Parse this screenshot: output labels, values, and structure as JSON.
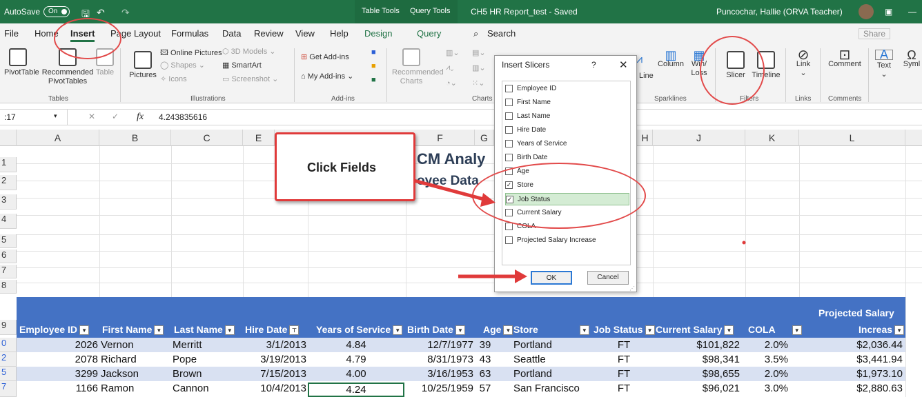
{
  "titlebar": {
    "autosave_label": "AutoSave",
    "autosave_state": "On",
    "context_tab_1": "Table Tools",
    "context_tab_2": "Query Tools",
    "doc_title": "CH5 HR Report_test - Saved",
    "user": "Puncochar, Hallie (ORVA Teacher)"
  },
  "tabs": [
    "File",
    "Home",
    "Insert",
    "Page Layout",
    "Formulas",
    "Data",
    "Review",
    "View",
    "Help",
    "Design",
    "Query"
  ],
  "search_label": "Search",
  "share_label": "Share",
  "ribbon": {
    "pivottable": "PivotTable",
    "recommended_pivottables_1": "Recommended",
    "recommended_pivottables_2": "PivotTables",
    "table": "Table",
    "tables_group": "Tables",
    "pictures": "Pictures",
    "online_pictures": "Online Pictures",
    "shapes": "Shapes",
    "icons": "Icons",
    "models_3d": "3D Models",
    "smartart": "SmartArt",
    "screenshot": "Screenshot",
    "illustrations_group": "Illustrations",
    "get_addins": "Get Add-ins",
    "my_addins": "My Add-ins",
    "addins_group": "Add-ins",
    "recommended_charts_1": "Recommended",
    "recommended_charts_2": "Charts",
    "charts_group": "Charts",
    "line": "Line",
    "column": "Column",
    "winloss_1": "Win/",
    "winloss_2": "Loss",
    "sparklines_group": "Sparklines",
    "slicer": "Slicer",
    "timeline": "Timeline",
    "filters_group": "Filters",
    "link": "Link",
    "links_group": "Links",
    "comment": "Comment",
    "comments_group": "Comments",
    "text": "Text",
    "symbols": "Syml"
  },
  "formula_bar": {
    "name_box": ":17",
    "fx": "fx",
    "value": "4.243835616"
  },
  "columns": [
    "A",
    "B",
    "C",
    "E",
    "F",
    "G",
    "H",
    "I",
    "J",
    "K",
    "L"
  ],
  "row_numbers": [
    "1",
    "2",
    "3",
    "4",
    "5",
    "6",
    "7",
    "8",
    "9",
    "0",
    "2",
    "5",
    "7"
  ],
  "background_text": {
    "title": "CM Analy",
    "subtitle": "oyee Data"
  },
  "table_headers": [
    "Employee ID",
    "First Name",
    "Last Name",
    "Hire Date",
    "Years of Service",
    "Birth Date",
    "Age",
    "Store",
    "Job Status",
    "Current Salary",
    "COLA",
    "Projected Salary",
    "Increas"
  ],
  "rows": [
    [
      "2026",
      "Vernon",
      "Merritt",
      "3/1/2013",
      "4.84",
      "12/7/1977",
      "39",
      "Portland",
      "FT",
      "$101,822",
      "2.0%",
      "$2,036.44"
    ],
    [
      "2078",
      "Richard",
      "Pope",
      "3/19/2013",
      "4.79",
      "8/31/1973",
      "43",
      "Seattle",
      "FT",
      "$98,341",
      "3.5%",
      "$3,441.94"
    ],
    [
      "3299",
      "Jackson",
      "Brown",
      "7/15/2013",
      "4.00",
      "3/16/1953",
      "63",
      "Portland",
      "FT",
      "$98,655",
      "2.0%",
      "$1,973.10"
    ],
    [
      "1166",
      "Ramon",
      "Cannon",
      "10/4/2013",
      "4.24",
      "10/25/1959",
      "57",
      "San Francisco",
      "FT",
      "$96,021",
      "3.0%",
      "$2,880.63"
    ]
  ],
  "dialog": {
    "title": "Insert Slicers",
    "help": "?",
    "close": "✕",
    "fields": [
      {
        "label": "Employee ID",
        "checked": false
      },
      {
        "label": "First Name",
        "checked": false
      },
      {
        "label": "Last Name",
        "checked": false
      },
      {
        "label": "Hire Date",
        "checked": false
      },
      {
        "label": "Years of Service",
        "checked": false
      },
      {
        "label": "Birth Date",
        "checked": false
      },
      {
        "label": "Age",
        "checked": false
      },
      {
        "label": "Store",
        "checked": true
      },
      {
        "label": "Job Status",
        "checked": true
      },
      {
        "label": "Current Salary",
        "checked": false
      },
      {
        "label": "COLA",
        "checked": false
      },
      {
        "label": "Projected Salary Increase",
        "checked": false
      }
    ],
    "ok": "OK",
    "cancel": "Cancel"
  },
  "callout": "Click Fields",
  "colors": {
    "excel_green": "#217346",
    "table_header": "#4472c4",
    "band": "#d9e1f2",
    "annotation": "#e03a3a"
  }
}
